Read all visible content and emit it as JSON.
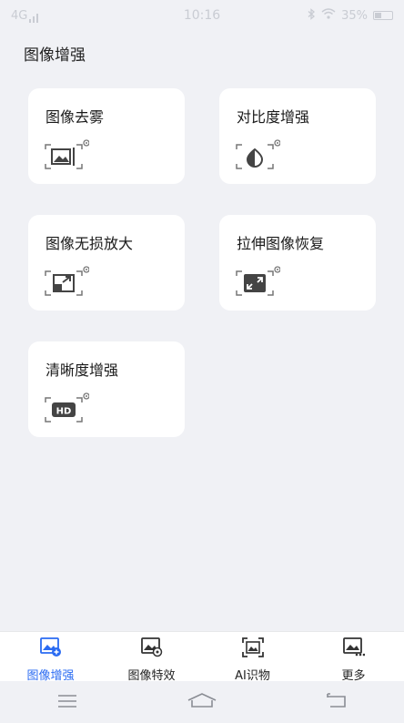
{
  "status": {
    "network": "4G",
    "time": "10:16",
    "battery_text": "35%",
    "battery_level": 0.35
  },
  "page": {
    "title": "图像增强"
  },
  "cards": [
    {
      "label": "图像去雾",
      "icon": "dehaze-icon"
    },
    {
      "label": "对比度增强",
      "icon": "contrast-icon"
    },
    {
      "label": "图像无损放大",
      "icon": "enlarge-icon"
    },
    {
      "label": "拉伸图像恢复",
      "icon": "stretch-restore-icon"
    },
    {
      "label": "清晰度增强",
      "icon": "hd-icon"
    }
  ],
  "tabs": [
    {
      "label": "图像增强",
      "icon": "image-enhance-icon",
      "active": true
    },
    {
      "label": "图像特效",
      "icon": "image-effects-icon",
      "active": false
    },
    {
      "label": "AI识物",
      "icon": "ai-recognize-icon",
      "active": false
    },
    {
      "label": "更多",
      "icon": "more-icon",
      "active": false
    }
  ],
  "colors": {
    "accent": "#2a6bf2",
    "background": "#f0f1f5",
    "card": "#ffffff"
  }
}
